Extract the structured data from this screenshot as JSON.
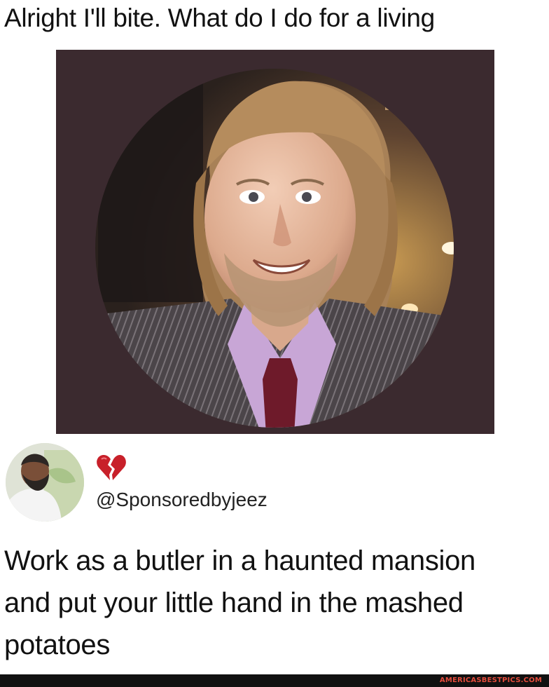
{
  "post": {
    "caption": "Alright I'll bite. What do I do for a living"
  },
  "reply": {
    "emoji": "broken-heart-icon",
    "handle": "@Sponsoredbyjeez",
    "text_lines": [
      "Work as a butler in a haunted mansion",
      "and put your little hand in the mashed",
      "potatoes"
    ]
  },
  "watermark": "AMERICASBESTPICS.COM",
  "colors": {
    "photo_background": "#3b2a2f",
    "heart": "#c8202a",
    "watermark": "#e44c3c"
  }
}
